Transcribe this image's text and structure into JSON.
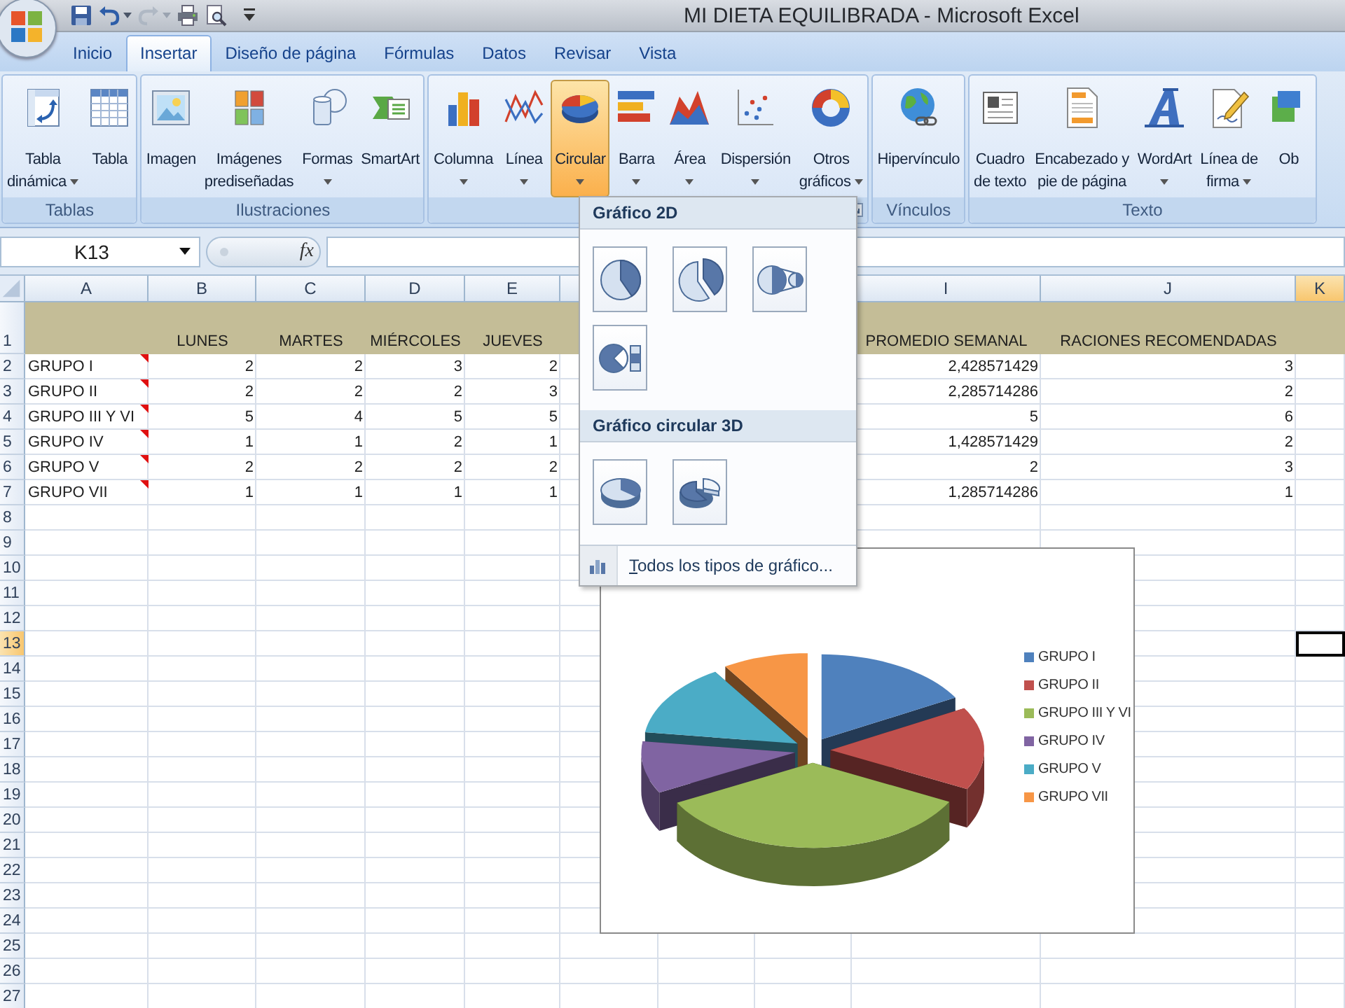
{
  "window": {
    "title": "MI DIETA EQUILIBRADA - Microsoft Excel"
  },
  "quick_access": [
    {
      "kind": "save",
      "disabled": false
    },
    {
      "kind": "undo",
      "disabled": false
    },
    {
      "kind": "redo",
      "disabled": true
    },
    {
      "kind": "print",
      "disabled": false
    },
    {
      "kind": "preview",
      "disabled": false
    }
  ],
  "tabs": [
    {
      "label": "Inicio",
      "selected": false
    },
    {
      "label": "Insertar",
      "selected": true
    },
    {
      "label": "Diseño de página",
      "selected": false
    },
    {
      "label": "Fórmulas",
      "selected": false
    },
    {
      "label": "Datos",
      "selected": false
    },
    {
      "label": "Revisar",
      "selected": false
    },
    {
      "label": "Vista",
      "selected": false
    }
  ],
  "ribbon": {
    "groups": [
      {
        "label": "Tablas",
        "launcher": false,
        "buttons": [
          {
            "kind": "pivot",
            "lines": [
              "Tabla",
              "dinámica"
            ],
            "caret": true,
            "pressed": false
          },
          {
            "kind": "table",
            "lines": [
              "Tabla"
            ],
            "caret": false,
            "pressed": false
          }
        ]
      },
      {
        "label": "Ilustraciones",
        "launcher": false,
        "buttons": [
          {
            "kind": "image",
            "lines": [
              "Imagen"
            ],
            "caret": false,
            "pressed": false
          },
          {
            "kind": "clipart",
            "lines": [
              "Imágenes",
              "prediseñadas"
            ],
            "caret": false,
            "pressed": false
          },
          {
            "kind": "shapes",
            "lines": [
              "Formas"
            ],
            "caret": true,
            "pressed": false
          },
          {
            "kind": "smartart",
            "lines": [
              "SmartArt"
            ],
            "caret": false,
            "pressed": false
          }
        ]
      },
      {
        "launcher": true,
        "buttons": [
          {
            "kind": "column",
            "lines": [
              "Columna"
            ],
            "caret": true,
            "pressed": false
          },
          {
            "kind": "line",
            "lines": [
              "Línea"
            ],
            "caret": true,
            "pressed": false
          },
          {
            "kind": "pie",
            "lines": [
              "Circular"
            ],
            "caret": true,
            "pressed": true
          },
          {
            "kind": "bar",
            "lines": [
              "Barra"
            ],
            "caret": true,
            "pressed": false
          },
          {
            "kind": "area",
            "lines": [
              "Área"
            ],
            "caret": true,
            "pressed": false
          },
          {
            "kind": "scatter",
            "lines": [
              "Dispersión"
            ],
            "caret": true,
            "pressed": false
          },
          {
            "kind": "donut",
            "lines": [
              "Otros",
              "gráficos"
            ],
            "caret": true,
            "pressed": false
          }
        ]
      },
      {
        "label": "Vínculos",
        "launcher": false,
        "buttons": [
          {
            "kind": "hyperlink",
            "lines": [
              "Hipervínculo"
            ],
            "caret": false,
            "pressed": false
          }
        ]
      },
      {
        "label": "Texto",
        "launcher": false,
        "buttons": [
          {
            "kind": "textbox",
            "lines": [
              "Cuadro",
              "de texto"
            ],
            "caret": false,
            "pressed": false
          },
          {
            "kind": "header",
            "lines": [
              "Encabezado y",
              "pie de página"
            ],
            "caret": false,
            "pressed": false
          },
          {
            "kind": "wordart",
            "lines": [
              "WordArt"
            ],
            "caret": true,
            "pressed": false
          },
          {
            "kind": "signature",
            "lines": [
              "Línea de",
              "firma"
            ],
            "caret": true,
            "pressed": false
          },
          {
            "kind": "object",
            "lines": [
              "Ob"
            ],
            "caret": false,
            "pressed": false
          }
        ]
      }
    ]
  },
  "formula_bar": {
    "name_box": "K13",
    "function_label": "fx"
  },
  "columns": [
    {
      "letter": "A",
      "selected": false
    },
    {
      "letter": "B",
      "selected": false
    },
    {
      "letter": "C",
      "selected": false
    },
    {
      "letter": "D",
      "selected": false
    },
    {
      "letter": "E",
      "selected": false
    },
    {
      "letter": "I",
      "selected": false
    },
    {
      "letter": "J",
      "selected": false
    },
    {
      "letter": "K",
      "selected": true
    }
  ],
  "rows": [
    {
      "number": "1",
      "kind": "header",
      "selected": false,
      "has_comment": false,
      "cells": {
        "B": "LUNES",
        "C": "MARTES",
        "D": "MIÉRCOLES",
        "E": "JUEVES",
        "I": "PROMEDIO SEMANAL",
        "J": "RACIONES RECOMENDADAS"
      }
    },
    {
      "number": "2",
      "kind": "data",
      "selected": false,
      "has_comment": true,
      "cells": {
        "A": "GRUPO I",
        "B": "2",
        "C": "2",
        "D": "3",
        "E": "2",
        "I": "2,428571429",
        "J": "3"
      }
    },
    {
      "number": "3",
      "kind": "data",
      "selected": false,
      "has_comment": true,
      "cells": {
        "A": "GRUPO II",
        "B": "2",
        "C": "2",
        "D": "2",
        "E": "3",
        "I": "2,285714286",
        "J": "2"
      }
    },
    {
      "number": "4",
      "kind": "data",
      "selected": false,
      "has_comment": true,
      "cells": {
        "A": "GRUPO III Y VI",
        "B": "5",
        "C": "4",
        "D": "5",
        "E": "5",
        "I": "5",
        "J": "6"
      }
    },
    {
      "number": "5",
      "kind": "data",
      "selected": false,
      "has_comment": true,
      "cells": {
        "A": "GRUPO IV",
        "B": "1",
        "C": "1",
        "D": "2",
        "E": "1",
        "I": "1,428571429",
        "J": "2"
      }
    },
    {
      "number": "6",
      "kind": "data",
      "selected": false,
      "has_comment": true,
      "cells": {
        "A": "GRUPO V",
        "B": "2",
        "C": "2",
        "D": "2",
        "E": "2",
        "I": "2",
        "J": "3"
      }
    },
    {
      "number": "7",
      "kind": "data",
      "selected": false,
      "has_comment": true,
      "cells": {
        "A": "GRUPO VII",
        "B": "1",
        "C": "1",
        "D": "1",
        "E": "1",
        "I": "1,285714286",
        "J": "1"
      }
    },
    {
      "number": "8",
      "kind": "data",
      "selected": false,
      "has_comment": false
    },
    {
      "number": "9",
      "kind": "data",
      "selected": false,
      "has_comment": false
    },
    {
      "number": "10",
      "kind": "data",
      "selected": false,
      "has_comment": false
    },
    {
      "number": "11",
      "kind": "data",
      "selected": false,
      "has_comment": false
    },
    {
      "number": "12",
      "kind": "data",
      "selected": false,
      "has_comment": false
    },
    {
      "number": "13",
      "kind": "data",
      "selected": true,
      "has_comment": false
    },
    {
      "number": "14",
      "kind": "data",
      "selected": false,
      "has_comment": false
    },
    {
      "number": "15",
      "kind": "data",
      "selected": false,
      "has_comment": false
    },
    {
      "number": "16",
      "kind": "data",
      "selected": false,
      "has_comment": false
    },
    {
      "number": "17",
      "kind": "data",
      "selected": false,
      "has_comment": false
    },
    {
      "number": "18",
      "kind": "data",
      "selected": false,
      "has_comment": false
    },
    {
      "number": "19",
      "kind": "data",
      "selected": false,
      "has_comment": false
    },
    {
      "number": "20",
      "kind": "data",
      "selected": false,
      "has_comment": false
    },
    {
      "number": "21",
      "kind": "data",
      "selected": false,
      "has_comment": false
    },
    {
      "number": "22",
      "kind": "data",
      "selected": false,
      "has_comment": false
    },
    {
      "number": "23",
      "kind": "data",
      "selected": false,
      "has_comment": false
    },
    {
      "number": "24",
      "kind": "data",
      "selected": false,
      "has_comment": false
    },
    {
      "number": "25",
      "kind": "data",
      "selected": false,
      "has_comment": false
    },
    {
      "number": "26",
      "kind": "data",
      "selected": false,
      "has_comment": false
    },
    {
      "number": "27",
      "kind": "data",
      "selected": false,
      "has_comment": false
    }
  ],
  "chart": {
    "legend": [
      {
        "label": "GRUPO I",
        "color": "#4f81bd"
      },
      {
        "label": "GRUPO II",
        "color": "#c0504d"
      },
      {
        "label": "GRUPO III Y VI",
        "color": "#9bbb59"
      },
      {
        "label": "GRUPO IV",
        "color": "#8064a2"
      },
      {
        "label": "GRUPO V",
        "color": "#4bacc6"
      },
      {
        "label": "GRUPO VII",
        "color": "#f79646"
      }
    ]
  },
  "chart_menu": {
    "sections": [
      {
        "title": "Gráfico 2D",
        "options": [
          {
            "kind": "pie"
          },
          {
            "kind": "exploded"
          },
          {
            "kind": "pieofpie"
          },
          {
            "kind": "barofpie"
          }
        ]
      },
      {
        "title": "Gráfico circular 3D",
        "options": [
          {
            "kind": "pie3d"
          },
          {
            "kind": "exploded3d"
          }
        ]
      }
    ],
    "footer": "Todos los tipos de gráfico..."
  }
}
